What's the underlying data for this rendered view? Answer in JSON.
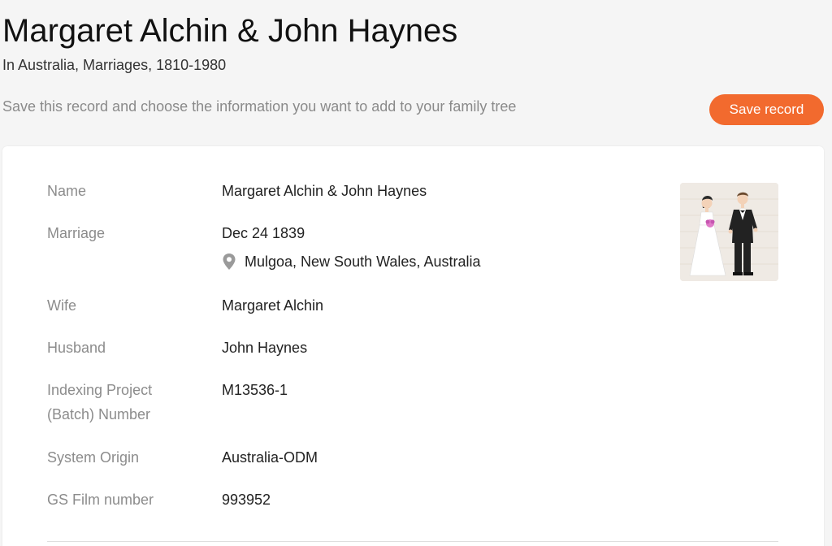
{
  "header": {
    "title": "Margaret Alchin & John Haynes",
    "subtitle": "In Australia, Marriages, 1810-1980",
    "save_hint": "Save this record and choose the information you want to add to your family tree",
    "save_button_label": "Save record"
  },
  "record": {
    "name_label": "Name",
    "name_value": "Margaret Alchin & John Haynes",
    "marriage_label": "Marriage",
    "marriage_date": "Dec 24 1839",
    "marriage_place": "Mulgoa, New South Wales, Australia",
    "wife_label": "Wife",
    "wife_value": "Margaret Alchin",
    "husband_label": "Husband",
    "husband_value": "John Haynes",
    "batch_label": "Indexing Project (Batch) Number",
    "batch_value": "M13536-1",
    "origin_label": "System Origin",
    "origin_value": "Australia-ODM",
    "film_label": "GS Film number",
    "film_value": "993952"
  },
  "image": {
    "icon": "wedding-couple-icon"
  },
  "colors": {
    "accent": "#f26a2e",
    "label": "#8c8c8c",
    "background": "#f5f5f5"
  }
}
